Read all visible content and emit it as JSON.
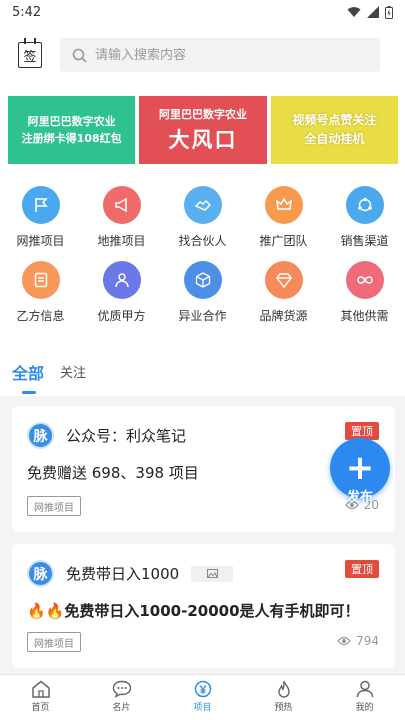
{
  "status": {
    "time": "5:42"
  },
  "header": {
    "checkin_label": "签",
    "search_placeholder": "请输入搜索内容"
  },
  "banners": [
    {
      "lines": [
        "阿里巴巴数字农业",
        "注册绑卡得108红包"
      ],
      "color": "#2fc28e"
    },
    {
      "lines": [
        "阿里巴巴数字农业",
        "大风口"
      ],
      "color": "#e24f55"
    },
    {
      "lines": [
        "视频号点赞关注",
        "全自动挂机"
      ],
      "color": "#e8dd45"
    }
  ],
  "categories": [
    {
      "label": "网推项目",
      "icon": "flag-icon",
      "color": "#4aa8ef"
    },
    {
      "label": "地推项目",
      "icon": "megaphone-icon",
      "color": "#f06a6a"
    },
    {
      "label": "找合伙人",
      "icon": "handshake-icon",
      "color": "#5ab0ee"
    },
    {
      "label": "推广团队",
      "icon": "crown-icon",
      "color": "#f79a4e"
    },
    {
      "label": "销售渠道",
      "icon": "network-icon",
      "color": "#4aa8ef"
    },
    {
      "label": "乙方信息",
      "icon": "document-icon",
      "color": "#f7985a"
    },
    {
      "label": "优质甲方",
      "icon": "user-icon",
      "color": "#6b78e8"
    },
    {
      "label": "异业合作",
      "icon": "cube-icon",
      "color": "#4d8fe8"
    },
    {
      "label": "品牌货源",
      "icon": "diamond-icon",
      "color": "#f58a5a"
    },
    {
      "label": "其他供需",
      "icon": "infinity-icon",
      "color": "#f06b7a"
    }
  ],
  "tabs": [
    {
      "label": "全部",
      "active": true
    },
    {
      "label": "关注",
      "active": false
    }
  ],
  "posts": [
    {
      "avatar_text": "脉",
      "title": "公众号：利众笔记",
      "pinned_label": "置顶",
      "description": "免费赠送 698、398 项目",
      "tag": "网推项目",
      "views": "20"
    },
    {
      "avatar_text": "脉",
      "title": "免费带日入1000",
      "pinned_label": "置顶",
      "description": "🔥🔥免费带日入1000-20000是人有手机即可！",
      "tag": "网推项目",
      "views": "794"
    }
  ],
  "fab": {
    "label": "发布"
  },
  "bottom_nav": [
    {
      "label": "首页",
      "icon": "home-icon"
    },
    {
      "label": "名片",
      "icon": "chat-icon"
    },
    {
      "label": "项目",
      "icon": "money-icon",
      "active": true
    },
    {
      "label": "预热",
      "icon": "fire-icon"
    },
    {
      "label": "我的",
      "icon": "profile-icon"
    }
  ],
  "colors": {
    "accent": "#2e8cf0",
    "pin": "#e34c3c"
  }
}
